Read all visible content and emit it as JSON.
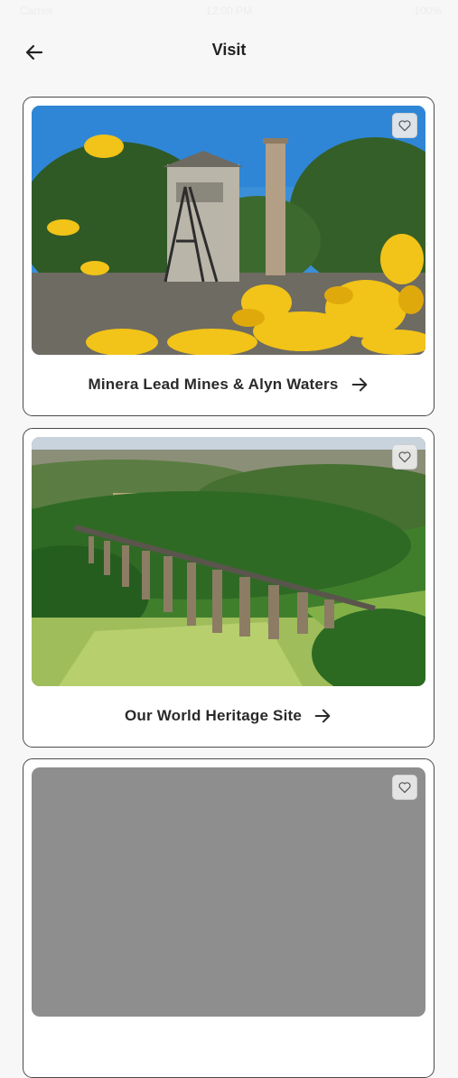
{
  "status_bar": {
    "carrier": "Carrier",
    "time": "12:00 PM",
    "battery": "100%"
  },
  "header": {
    "title": "Visit",
    "back_icon": "arrow-left-icon"
  },
  "cards": [
    {
      "title": "Minera Lead Mines & Alyn Waters",
      "favorite_icon": "heart-outline-icon",
      "arrow_icon": "arrow-right-icon"
    },
    {
      "title": "Our World Heritage Site",
      "favorite_icon": "heart-outline-icon",
      "arrow_icon": "arrow-right-icon"
    },
    {
      "title": "",
      "favorite_icon": "heart-outline-icon"
    }
  ],
  "colors": {
    "background": "#f7f7f7",
    "card_border": "#4a4a4a",
    "text": "#2a2a2a"
  }
}
